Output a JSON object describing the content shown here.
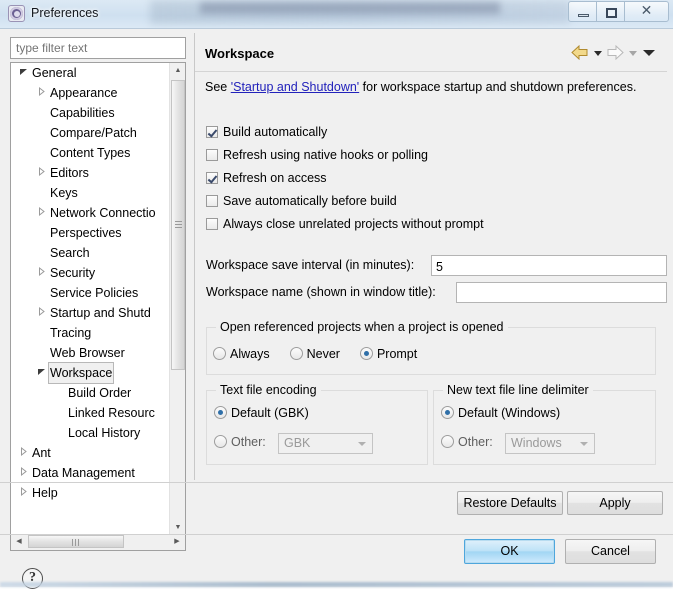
{
  "window": {
    "title": "Preferences",
    "icon": "gear-icon",
    "minimize_tooltip": "Minimize",
    "maximize_tooltip": "Maximize",
    "close_glyph": "✕"
  },
  "sidebar": {
    "filter": {
      "placeholder": "type filter text",
      "value": ""
    },
    "tree": [
      {
        "label": "General",
        "level": 0,
        "expander": "open",
        "selected": false
      },
      {
        "label": "Appearance",
        "level": 1,
        "expander": "closed",
        "selected": false
      },
      {
        "label": "Capabilities",
        "level": 1,
        "expander": "none",
        "selected": false
      },
      {
        "label": "Compare/Patch",
        "level": 1,
        "expander": "none",
        "selected": false
      },
      {
        "label": "Content Types",
        "level": 1,
        "expander": "none",
        "selected": false
      },
      {
        "label": "Editors",
        "level": 1,
        "expander": "closed",
        "selected": false
      },
      {
        "label": "Keys",
        "level": 1,
        "expander": "none",
        "selected": false
      },
      {
        "label": "Network Connectio",
        "level": 1,
        "expander": "closed",
        "selected": false
      },
      {
        "label": "Perspectives",
        "level": 1,
        "expander": "none",
        "selected": false
      },
      {
        "label": "Search",
        "level": 1,
        "expander": "none",
        "selected": false
      },
      {
        "label": "Security",
        "level": 1,
        "expander": "closed",
        "selected": false
      },
      {
        "label": "Service Policies",
        "level": 1,
        "expander": "none",
        "selected": false
      },
      {
        "label": "Startup and Shutd",
        "level": 1,
        "expander": "closed",
        "selected": false
      },
      {
        "label": "Tracing",
        "level": 1,
        "expander": "none",
        "selected": false
      },
      {
        "label": "Web Browser",
        "level": 1,
        "expander": "none",
        "selected": false
      },
      {
        "label": "Workspace",
        "level": 1,
        "expander": "open",
        "selected": true
      },
      {
        "label": "Build Order",
        "level": 2,
        "expander": "none",
        "selected": false
      },
      {
        "label": "Linked Resourc",
        "level": 2,
        "expander": "none",
        "selected": false
      },
      {
        "label": "Local History",
        "level": 2,
        "expander": "none",
        "selected": false
      },
      {
        "label": "Ant",
        "level": 0,
        "expander": "closed",
        "selected": false
      },
      {
        "label": "Data Management",
        "level": 0,
        "expander": "closed",
        "selected": false
      },
      {
        "label": "Help",
        "level": 0,
        "expander": "closed",
        "selected": false
      }
    ]
  },
  "page": {
    "title": "Workspace",
    "nav": {
      "back": "back-arrow",
      "back_menu": "back-dropdown",
      "forward": "forward-arrow",
      "forward_menu": "forward-dropdown",
      "view_menu": "view-menu"
    },
    "intro": {
      "prefix": "See ",
      "link": "'Startup and Shutdown'",
      "suffix": " for workspace startup and shutdown preferences."
    },
    "checkboxes": [
      {
        "label": "Build automatically",
        "checked": true
      },
      {
        "label": "Refresh using native hooks or polling",
        "checked": false
      },
      {
        "label": "Refresh on access",
        "checked": true
      },
      {
        "label": "Save automatically before build",
        "checked": false
      },
      {
        "label": "Always close unrelated projects without prompt",
        "checked": false
      }
    ],
    "fields": [
      {
        "label": "Workspace save interval (in minutes):",
        "value": "5"
      },
      {
        "label": "Workspace name (shown in window title):",
        "value": ""
      }
    ],
    "referenced_projects": {
      "title": "Open referenced projects when a project is opened",
      "options": [
        {
          "label": "Always",
          "selected": false
        },
        {
          "label": "Never",
          "selected": false
        },
        {
          "label": "Prompt",
          "selected": true
        }
      ]
    },
    "encoding": {
      "title": "Text file encoding",
      "default_label": "Default (GBK)",
      "default_selected": true,
      "other_label": "Other:",
      "other_selected": false,
      "other_value": "GBK"
    },
    "delimiter": {
      "title": "New text file line delimiter",
      "default_label": "Default (Windows)",
      "default_selected": true,
      "other_label": "Other:",
      "other_selected": false,
      "other_value": "Windows"
    }
  },
  "buttons": {
    "restore_defaults": "Restore Defaults",
    "apply": "Apply",
    "ok": "OK",
    "cancel": "Cancel",
    "help": "?"
  },
  "colors": {
    "accent": "#2f6fa8",
    "link": "#2222bb",
    "default_button": "#a2d6f3"
  }
}
